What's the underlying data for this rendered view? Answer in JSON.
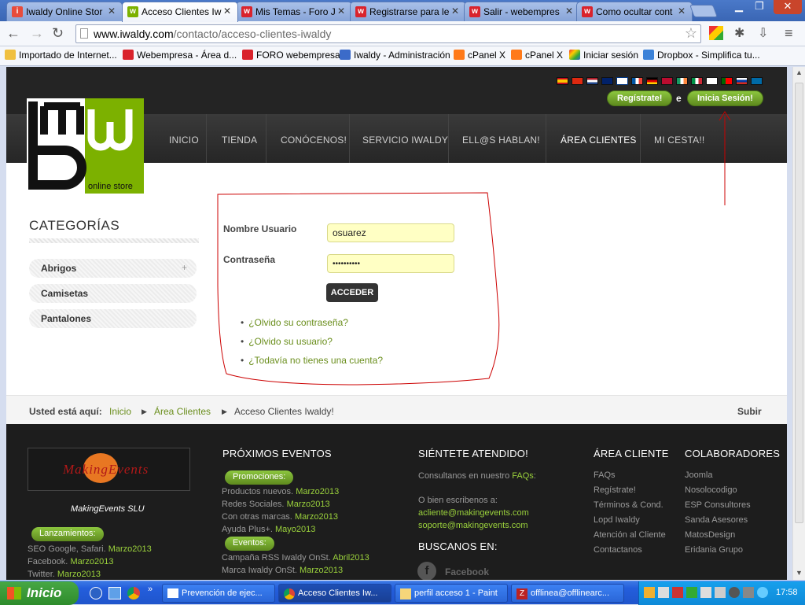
{
  "browser": {
    "tabs": [
      {
        "label": "Iwaldy Online Stor",
        "color": "#e74c3c"
      },
      {
        "label": "Acceso Clientes Iw",
        "color": "#7cb100"
      },
      {
        "label": "Mis Temas - Foro J",
        "color": "#d9232c"
      },
      {
        "label": "Registrarse para le",
        "color": "#d9232c"
      },
      {
        "label": "Salir - webempres",
        "color": "#d9232c"
      },
      {
        "label": "Como ocultar cont",
        "color": "#d9232c"
      }
    ],
    "url_host": "www.iwaldy.com",
    "url_path": "/contacto/acceso-clientes-iwaldy",
    "bookmarks": [
      "Importado de Internet...",
      "Webempresa - Área d...",
      "FORO webempresa",
      "Iwaldy - Administración",
      "cPanel X",
      "cPanel X",
      "Iniciar sesión",
      "Dropbox - Simplifica tu..."
    ]
  },
  "site": {
    "logo_text": "online store",
    "register_label": "Regístrate!",
    "and_label": "e",
    "login_label": "Inicia Sesión!",
    "menu": [
      "INICIO",
      "TIENDA",
      "CONÓCENOS!",
      "SERVICIO IWALDY",
      "ELL@S HABLAN!",
      "ÁREA CLIENTES",
      "MI CESTA!!"
    ],
    "categories_title": "CATEGORÍAS",
    "categories": [
      "Abrigos",
      "Camisetas",
      "Pantalones"
    ],
    "form": {
      "user_label": "Nombre Usuario",
      "user_value": "osuarez",
      "pass_label": "Contraseña",
      "pass_value": "••••••••••",
      "submit": "ACCEDER",
      "links": [
        "¿Olvido su contraseña?",
        "¿Olvido su usuario?",
        "¿Todavía no tienes una cuenta?"
      ]
    },
    "breadcrumb": {
      "prefix": "Usted está aquí:",
      "items": [
        "Inicio",
        "Área Clientes",
        "Acceso Clientes Iwaldy!"
      ],
      "up": "Subir"
    },
    "footer": {
      "partner_name": "MakingEvents SLU",
      "partner_logo_text": "MakingEvents",
      "launch_pill": "Lanzamientos:",
      "launches": [
        {
          "text": "SEO Google, Safari.",
          "date": "Marzo2013"
        },
        {
          "text": "Facebook.",
          "date": "Marzo2013"
        },
        {
          "text": "Twitter.",
          "date": "Marzo2013"
        }
      ],
      "events_title": "PRÓXIMOS EVENTOS",
      "promo_pill": "Promociones:",
      "promos": [
        {
          "text": "Productos nuevos.",
          "date": "Marzo2013"
        },
        {
          "text": "Redes Sociales.",
          "date": "Marzo2013"
        },
        {
          "text": "Con otras marcas.",
          "date": "Marzo2013"
        },
        {
          "text": "Ayuda Plus+.",
          "date": "Mayo2013"
        }
      ],
      "events_pill": "Eventos:",
      "events": [
        {
          "text": "Campaña RSS Iwaldy OnSt.",
          "date": "Abril2013"
        },
        {
          "text": "Marca Iwaldy OnSt.",
          "date": "Marzo2013"
        }
      ],
      "attended_title": "SIÉNTETE ATENDIDO!",
      "attended_text1": "Consultanos en nuestro",
      "attended_faqs": "FAQs",
      "attended_text2": "O bien escribenos a:",
      "emails": [
        "acliente@makingevents.com",
        "soporte@makingevents.com"
      ],
      "search_title": "BUSCANOS EN:",
      "facebook": "Facebook",
      "client_title": "ÁREA CLIENTE",
      "client_links": [
        "FAQs",
        "Regístrate!",
        "Términos & Cond.",
        "Lopd Iwaldy",
        "Atención al Cliente",
        "Contactanos"
      ],
      "collab_title": "COLABORADORES",
      "collab_links": [
        "Joomla",
        "Nosolocodigo",
        "ESP Consultores",
        "Sanda Asesores",
        "MatosDesign",
        "Eridania Grupo"
      ]
    }
  },
  "taskbar": {
    "start": "Inicio",
    "tasks": [
      "Prevención de ejec...",
      "Acceso Clientes Iw...",
      "perfil acceso 1 - Paint",
      "offlinea@offlinearc..."
    ],
    "clock": "17:58"
  }
}
